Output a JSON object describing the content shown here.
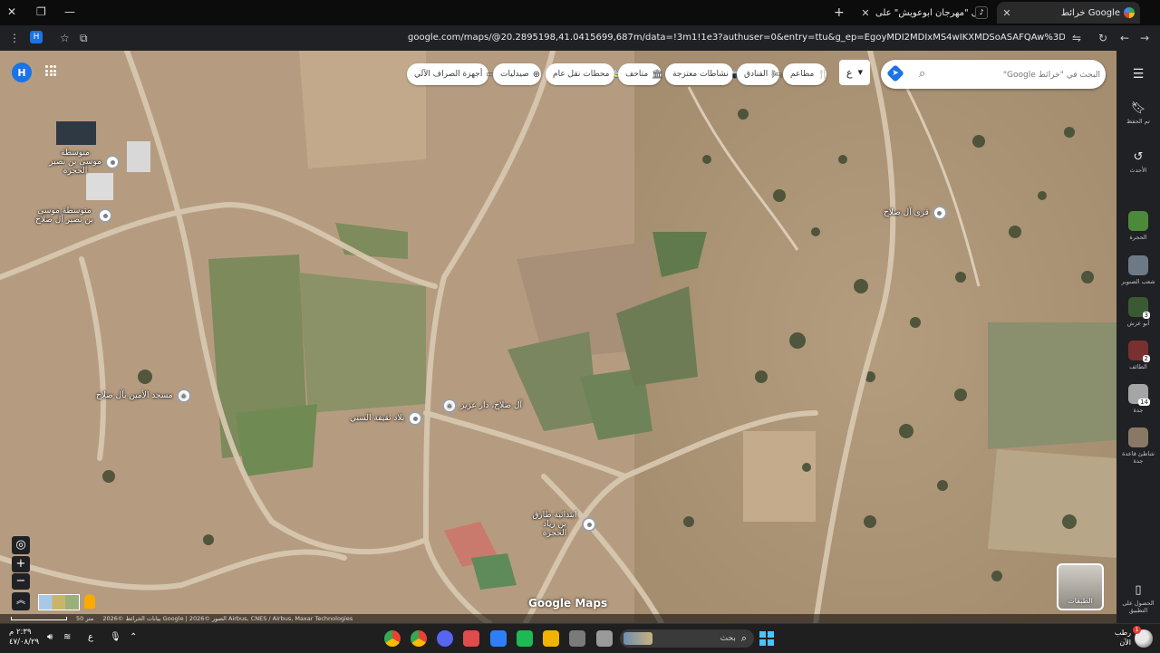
{
  "browser": {
    "tabs": [
      {
        "title": "خرائط Google",
        "active": true
      },
      {
        "title": "اعثر على \"مهرجان ابوعويش\" على...",
        "active": false
      }
    ],
    "new_tab": "+",
    "url": "google.com/maps/@20.2895198,41.0415699,687m/data=!3m1!1e3?authuser=0&entry=ttu&g_ep=EgoyMDI2MDIxMS4wIKXMDSoASAFQAw%3D%3D",
    "profile_initial": "H"
  },
  "map": {
    "search": {
      "placeholder": "البحث في \"خرائط Google\""
    },
    "language_button": "ع",
    "chips": [
      {
        "label": "مطاعم",
        "icon": "restaurant-icon",
        "glyph": "🍴"
      },
      {
        "label": "الفنادق",
        "icon": "hotel-icon",
        "glyph": "🛏"
      },
      {
        "label": "نشاطات معتزجة",
        "icon": "camera-icon",
        "glyph": "📷"
      },
      {
        "label": "متاحف",
        "icon": "museum-icon",
        "glyph": "🏛"
      },
      {
        "label": "محطات نقل عام",
        "icon": "transit-icon",
        "glyph": "🚉"
      },
      {
        "label": "صيدليات",
        "icon": "pharmacy-icon",
        "glyph": "⊕"
      },
      {
        "label": "أجهزة الصراف الآلي",
        "icon": "atm-icon",
        "glyph": "▭"
      }
    ],
    "account_initial": "H",
    "places": [
      {
        "name": "متوسطة موسى بن نصير الحجرة",
        "type": "school"
      },
      {
        "name": "متوسطة موسى بن نصير آل صلاح",
        "type": "school"
      },
      {
        "name": "قرى آل صلاح",
        "type": "place"
      },
      {
        "name": "مسجد الأمين بآل صلاح",
        "type": "mosque"
      },
      {
        "name": "آل صلاح، دار عزيز",
        "type": "mosque"
      },
      {
        "name": "بلاد ثقيفة السني",
        "type": "place"
      },
      {
        "name": "ابتدائية طارق بن زياد الحجرة",
        "type": "school"
      }
    ],
    "logo": "Google Maps",
    "layers_label": "الطبقات",
    "attribution": "بيانات الخرائط ©2026 Google | الصور ©2026 Airbus, CNES / Airbus, Maxar Technologies",
    "scale": "50 متر"
  },
  "sidebar": [
    {
      "label": "تم الحفظ",
      "icon": "bookmark-icon"
    },
    {
      "label": "الأحدث",
      "icon": "history-icon"
    },
    {
      "label": "الحجرة",
      "thumb": "#4c8a3a"
    },
    {
      "label": "شعب الصنوبر",
      "thumb": "#6d7a86"
    },
    {
      "label": "أبو عرش",
      "thumb": "#3a5a34",
      "count": "3"
    },
    {
      "label": "الطائف",
      "thumb": "#7a3030",
      "count": "2"
    },
    {
      "label": "جدة",
      "thumb": "#a5a5a5",
      "count": "14"
    },
    {
      "label": "شاطئ قاعدة جدة",
      "thumb": "#8a7866"
    },
    {
      "label": "الحصول على التطبيق",
      "icon": "phone-icon"
    }
  ],
  "taskbar": {
    "search_placeholder": "بحث",
    "time": "٢:٣٩ م",
    "date": "٤٧/٠٨/٢٩",
    "weather": "رطب الآن",
    "weather_badge": "1",
    "lang": "ع"
  }
}
